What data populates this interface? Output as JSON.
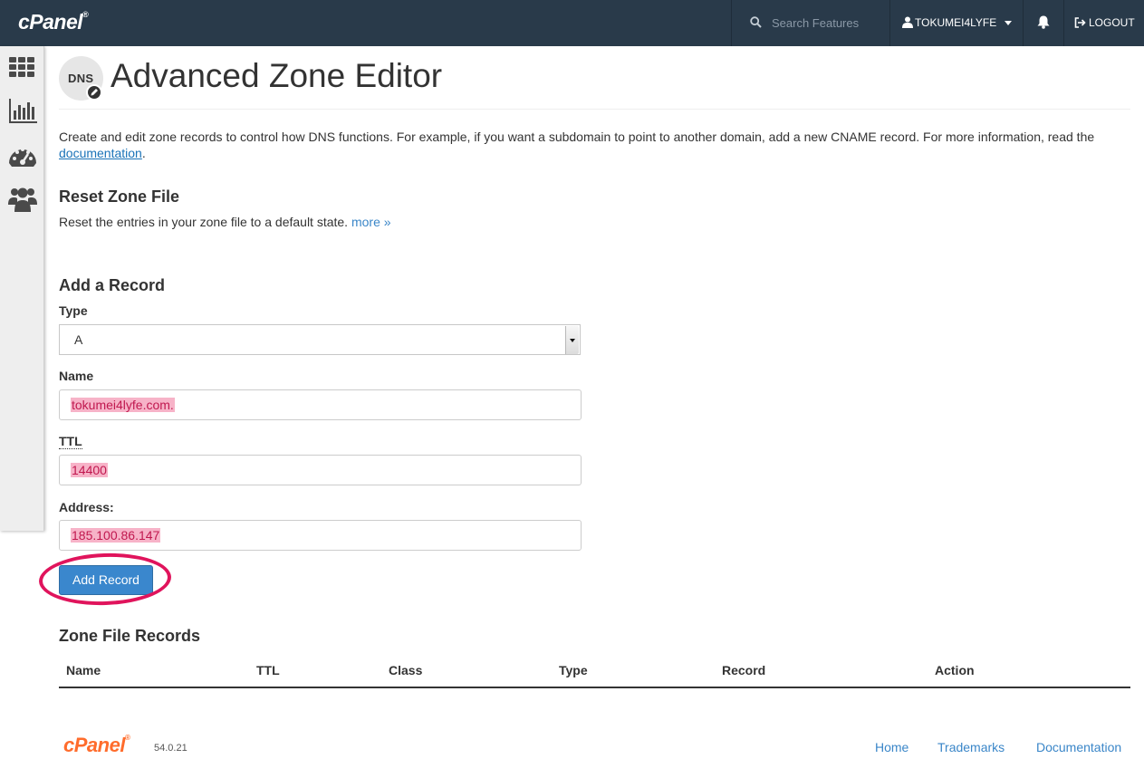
{
  "topbar": {
    "logo": "cPanel",
    "search_placeholder": "Search Features",
    "username": "TOKUMEI4LYFE",
    "logout": "LOGOUT"
  },
  "sidebar": {
    "items": [
      {
        "icon": "apps-grid-icon"
      },
      {
        "icon": "statistics-chart-icon"
      },
      {
        "icon": "dashboard-gauge-icon"
      },
      {
        "icon": "users-icon"
      }
    ]
  },
  "page": {
    "icon_text": "DNS",
    "title": "Advanced Zone Editor",
    "intro_text": "Create and edit zone records to control how DNS functions. For example, if you want a subdomain to point to another domain, add a new CNAME record. For more information, read the ",
    "intro_link": "documentation",
    "intro_end": "."
  },
  "reset": {
    "heading": "Reset Zone File",
    "text": "Reset the entries in your zone file to a default state.",
    "more_link": "more »"
  },
  "add_record": {
    "heading": "Add a Record",
    "type_label": "Type",
    "type_value": "A",
    "name_label": "Name",
    "name_value": "tokumei4lyfe.com.",
    "ttl_label": "TTL",
    "ttl_value": "14400",
    "address_label": "Address:",
    "address_value": "185.100.86.147",
    "button_label": "Add Record"
  },
  "zone_records": {
    "heading": "Zone File Records",
    "columns": [
      "Name",
      "TTL",
      "Class",
      "Type",
      "Record",
      "Action"
    ]
  },
  "footer": {
    "logo": "cPanel",
    "version": "54.0.21",
    "links": [
      "Home",
      "Trademarks",
      "Documentation"
    ]
  },
  "colors": {
    "topbar": "#293a4a",
    "primary_button": "#3a87cd",
    "link": "#3a86c8",
    "highlight_circle": "#e0145c",
    "brand_orange": "#ff6c2c"
  }
}
